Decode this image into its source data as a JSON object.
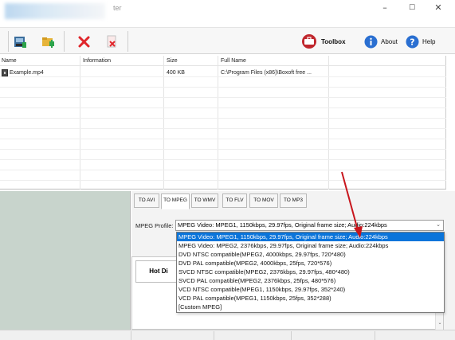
{
  "window": {
    "title_fragment": "ter",
    "controls": {
      "minimize": "–",
      "maximize": "☐",
      "close": "✕"
    }
  },
  "toolbar": {
    "icons": [
      "add-file-icon",
      "add-folder-icon",
      "remove-icon",
      "clear-icon"
    ],
    "toolbox_label": "Toolbox",
    "about_label": "About",
    "help_label": "Help",
    "colors": {
      "toolbox_red": "#c0272d",
      "info_blue": "#2a6fd1",
      "remove_red": "#e0262b"
    }
  },
  "file_list": {
    "columns": [
      "Name",
      "Information",
      "Size",
      "Full Name"
    ],
    "rows": [
      {
        "name": "Example.mp4",
        "information": "",
        "size": "400 KB",
        "full_name": "C:\\Program Files (x86)\\Boxoft free ..."
      }
    ]
  },
  "format_tabs": [
    "TO AVI",
    "TO MPEG",
    "TO WMV",
    "TO FLV",
    "TO MOV",
    "TO MP3"
  ],
  "active_tab": "TO MPEG",
  "mpeg_profile": {
    "label": "MPEG Profile:",
    "value": "MPEG Video: MPEG1, 1150kbps, 29.97fps, Original frame size; Audio:224kbps",
    "options": [
      "MPEG Video: MPEG1, 1150kbps, 29.97fps, Original frame size; Audio:224kbps",
      "MPEG Video: MPEG2, 2376kbps, 29.97fps, Original frame size; Audio:224kbps",
      "DVD NTSC compatible(MPEG2, 4000kbps, 29.97fps, 720*480)",
      "DVD PAL compatible(MPEG2, 4000kbps, 25fps, 720*576)",
      "SVCD NTSC compatible(MPEG2, 2376kbps, 29.97fps, 480*480)",
      "SVCD PAL compatible(MPEG2, 2376kbps, 25fps, 480*576)",
      "VCD NTSC compatible(MPEG1, 1150kbps, 29.97fps, 352*240)",
      "VCD PAL compatible(MPEG1, 1150kbps, 25fps, 352*288)",
      "[Custom MPEG]"
    ],
    "selected_index": 0
  },
  "hot_tab_label": "Hot Di",
  "colors": {
    "selection": "#0a74da",
    "arrow": "#c8161d",
    "preview_bg": "#c8d4cc"
  }
}
